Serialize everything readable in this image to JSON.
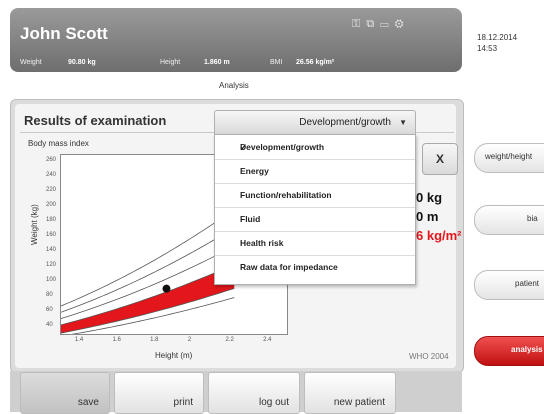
{
  "header": {
    "patient_name": "John Scott",
    "weight_label": "Weight",
    "weight_value": "90.80 kg",
    "height_label": "Height",
    "height_value": "1.860 m",
    "bmi_label": "BMI",
    "bmi_value": "26.56 kg/m²",
    "date": "18.12.2014",
    "time": "14:53",
    "section": "Analysis"
  },
  "panel": {
    "title": "Results of examination",
    "close_label": "X",
    "dropdown": {
      "selected": "Development/growth",
      "options": [
        "Development/growth",
        "Energy",
        "Function/rehabilitation",
        "Fluid",
        "Health risk",
        "Raw data for impedance"
      ]
    },
    "partial_values": {
      "weight": "0 kg",
      "height": "0 m",
      "bmi": "6 kg/m²"
    }
  },
  "chart_data": {
    "type": "line",
    "title": "Body mass index",
    "xlabel": "Height (m)",
    "ylabel": "Weight (kg)",
    "source_note": "WHO 2004",
    "xlim": [
      1.3,
      2.5
    ],
    "ylim": [
      30,
      270
    ],
    "x_ticks": [
      "1.4",
      "1.6",
      "1.8",
      "2",
      "2.2",
      "2.4"
    ],
    "y_ticks": [
      "260",
      "240",
      "220",
      "200",
      "180",
      "160",
      "140",
      "120",
      "100",
      "80",
      "60",
      "40"
    ],
    "series": [
      {
        "bmi": 16
      },
      {
        "bmi": 18.5
      },
      {
        "bmi": 25
      },
      {
        "bmi": 30
      },
      {
        "bmi": 35
      },
      {
        "bmi": 40
      }
    ],
    "normal_band_bmi": [
      18.5,
      25
    ],
    "band_color": "#e3161b",
    "point": {
      "x": 1.86,
      "y": 90.8
    }
  },
  "sidebar": {
    "buttons": [
      "weight/height",
      "bia",
      "patient",
      "analysis"
    ],
    "active": "analysis"
  },
  "toolbar": {
    "save": "save",
    "print": "print",
    "logout": "log out",
    "new_patient": "new patient"
  }
}
